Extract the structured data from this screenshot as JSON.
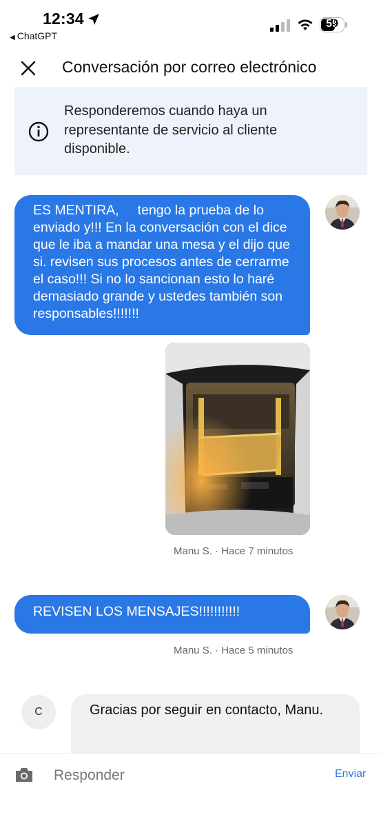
{
  "status_bar": {
    "time": "12:34",
    "back_app": "ChatGPT",
    "battery": "59"
  },
  "header": {
    "title": "Conversación por correo electrónico",
    "close_icon": "close-icon"
  },
  "banner": {
    "icon": "info-icon",
    "text": "Responderemos cuando haya un representante de servicio al cliente disponible."
  },
  "messages": [
    {
      "sender": "user",
      "text": "ES MENTIRA,     tengo la prueba de lo enviado y!!! En la conversación con el dice que le iba a mandar una mesa y el dijo que si. revisen sus procesos antes de cerrarme el caso!!! Si no lo sancionan esto lo haré demasiado grande y ustedes también son responsables!!!!!!!",
      "attachment": "photo",
      "meta": "Manu S. · Hace 7 minutos"
    },
    {
      "sender": "user",
      "text": "REVISEN LOS MENSAJES!!!!!!!!!!!",
      "meta": "Manu S. · Hace 5 minutos"
    },
    {
      "sender": "agent",
      "avatar_initial": "C",
      "text": "Gracias por seguir en contacto, Manu."
    }
  ],
  "composer": {
    "placeholder": "Responder",
    "send_label": "Enviar",
    "camera_icon": "camera-icon"
  },
  "colors": {
    "accent": "#2a78e6",
    "banner_bg": "#eef3fb",
    "agent_bubble_bg": "#f0f0f0"
  }
}
